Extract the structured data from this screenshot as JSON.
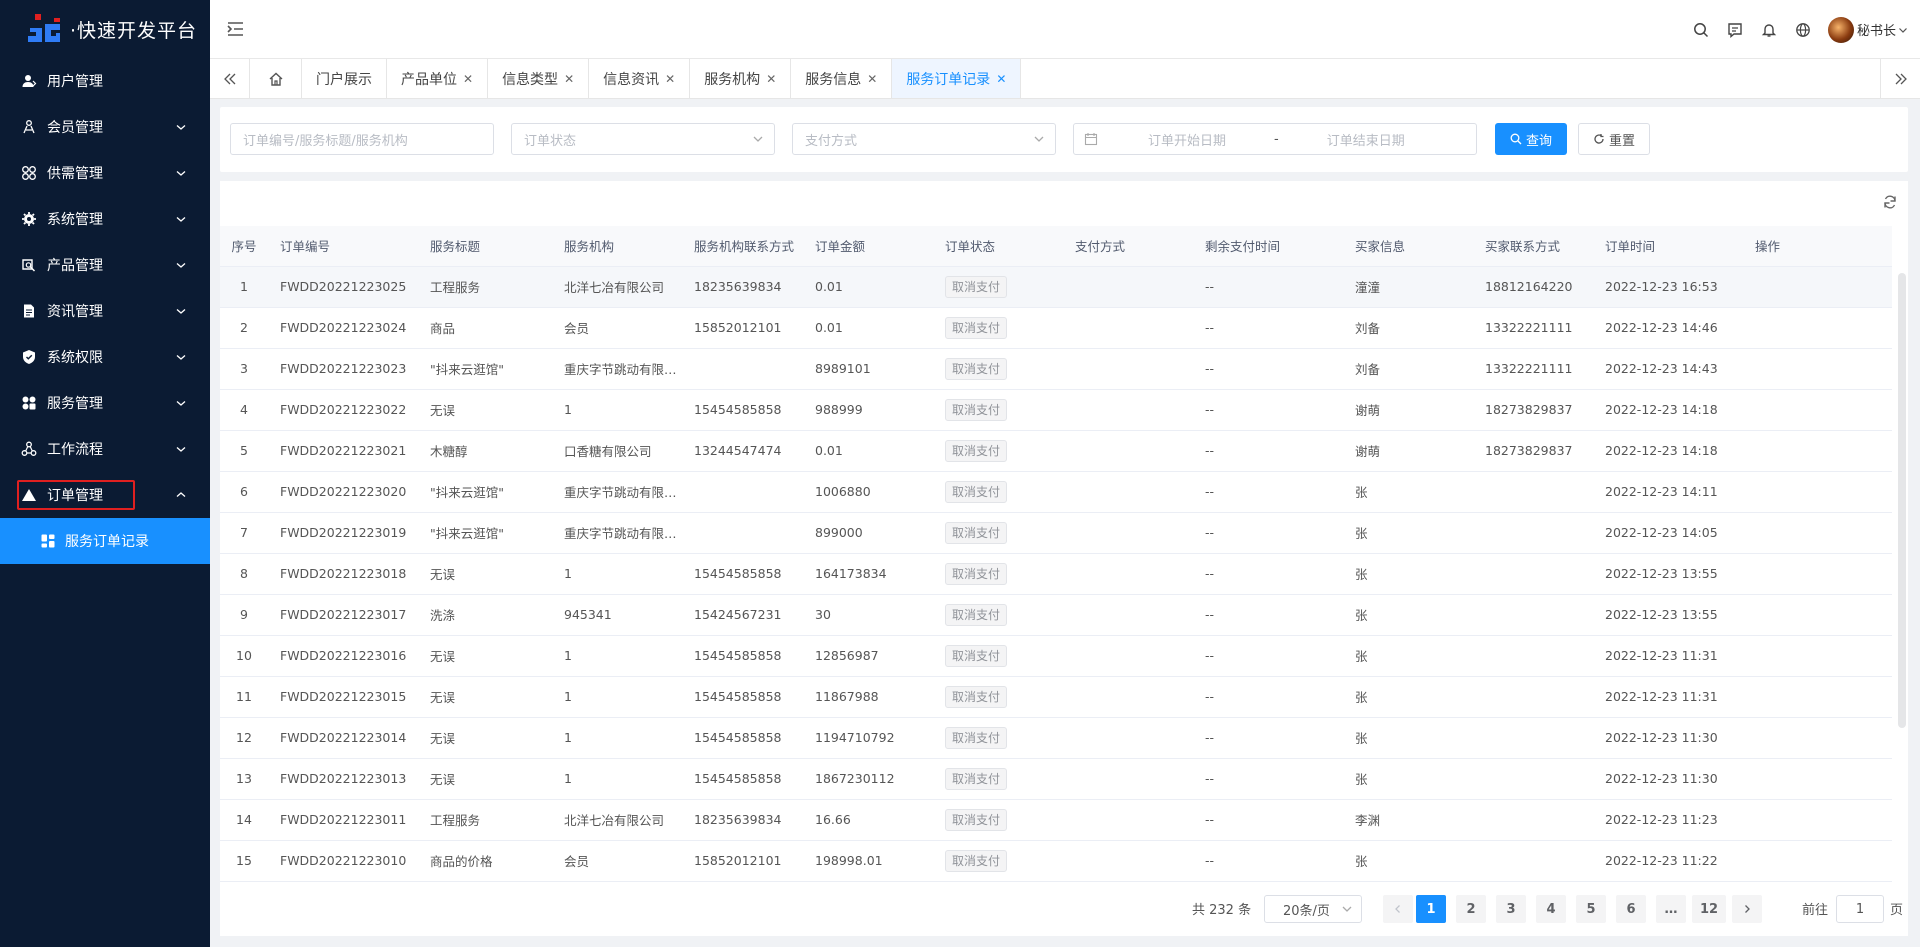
{
  "app": {
    "title": "·快速开发平台"
  },
  "sidebar": {
    "items": [
      {
        "label": "用户管理",
        "icon": "user-icon"
      },
      {
        "label": "会员管理",
        "icon": "members-icon"
      },
      {
        "label": "供需管理",
        "icon": "supply-icon"
      },
      {
        "label": "系统管理",
        "icon": "gear-icon"
      },
      {
        "label": "产品管理",
        "icon": "product-icon"
      },
      {
        "label": "资讯管理",
        "icon": "document-icon"
      },
      {
        "label": "系统权限",
        "icon": "shield-icon"
      },
      {
        "label": "服务管理",
        "icon": "grid-icon"
      },
      {
        "label": "工作流程",
        "icon": "workflow-icon"
      },
      {
        "label": "订单管理",
        "icon": "triangle-icon"
      }
    ],
    "sub_item": {
      "label": "服务订单记录",
      "icon": "dashboard-icon"
    }
  },
  "header": {
    "user_name": "秘书长"
  },
  "tabs": [
    {
      "label": "门户展示",
      "closable": false
    },
    {
      "label": "产品单位",
      "closable": true
    },
    {
      "label": "信息类型",
      "closable": true
    },
    {
      "label": "信息资讯",
      "closable": true
    },
    {
      "label": "服务机构",
      "closable": true
    },
    {
      "label": "服务信息",
      "closable": true
    },
    {
      "label": "服务订单记录",
      "closable": true,
      "active": true
    }
  ],
  "filters": {
    "keyword_placeholder": "订单编号/服务标题/服务机构",
    "status_placeholder": "订单状态",
    "pay_placeholder": "支付方式",
    "start_date_placeholder": "订单开始日期",
    "date_separator": "-",
    "end_date_placeholder": "订单结束日期",
    "search_label": "查询",
    "reset_label": "重置"
  },
  "table": {
    "columns": [
      "序号",
      "订单编号",
      "服务标题",
      "服务机构",
      "服务机构联系方式",
      "订单金额",
      "订单状态",
      "支付方式",
      "剩余支付时间",
      "买家信息",
      "买家联系方式",
      "订单时间",
      "操作"
    ],
    "rows": [
      [
        "1",
        "FWDD20221223025",
        "工程服务",
        "北洋七冶有限公司",
        "18235639834",
        "0.01",
        "取消支付",
        "",
        "--",
        "潼潼",
        "18812164220",
        "2022-12-23 16:53"
      ],
      [
        "2",
        "FWDD20221223024",
        "商品",
        "会员",
        "15852012101",
        "0.01",
        "取消支付",
        "",
        "--",
        "刘备",
        "13322221111",
        "2022-12-23 14:46"
      ],
      [
        "3",
        "FWDD20221223023",
        "\"抖来云逛馆\"",
        "重庆字节跳动有限公司",
        "",
        "8989101",
        "取消支付",
        "",
        "--",
        "刘备",
        "13322221111",
        "2022-12-23 14:43"
      ],
      [
        "4",
        "FWDD20221223022",
        "无误",
        "1",
        "15454585858",
        "988999",
        "取消支付",
        "",
        "--",
        "谢萌",
        "18273829837",
        "2022-12-23 14:18"
      ],
      [
        "5",
        "FWDD20221223021",
        "木糖醇",
        "口香糖有限公司",
        "13244547474",
        "0.01",
        "取消支付",
        "",
        "--",
        "谢萌",
        "18273829837",
        "2022-12-23 14:18"
      ],
      [
        "6",
        "FWDD20221223020",
        "\"抖来云逛馆\"",
        "重庆字节跳动有限公司",
        "",
        "1006880",
        "取消支付",
        "",
        "--",
        "张",
        "",
        "2022-12-23 14:11"
      ],
      [
        "7",
        "FWDD20221223019",
        "\"抖来云逛馆\"",
        "重庆字节跳动有限公司",
        "",
        "899000",
        "取消支付",
        "",
        "--",
        "张",
        "",
        "2022-12-23 14:05"
      ],
      [
        "8",
        "FWDD20221223018",
        "无误",
        "1",
        "15454585858",
        "164173834",
        "取消支付",
        "",
        "--",
        "张",
        "",
        "2022-12-23 13:55"
      ],
      [
        "9",
        "FWDD20221223017",
        "洗涤",
        "945341",
        "15424567231",
        "30",
        "取消支付",
        "",
        "--",
        "张",
        "",
        "2022-12-23 13:55"
      ],
      [
        "10",
        "FWDD20221223016",
        "无误",
        "1",
        "15454585858",
        "12856987",
        "取消支付",
        "",
        "--",
        "张",
        "",
        "2022-12-23 11:31"
      ],
      [
        "11",
        "FWDD20221223015",
        "无误",
        "1",
        "15454585858",
        "11867988",
        "取消支付",
        "",
        "--",
        "张",
        "",
        "2022-12-23 11:31"
      ],
      [
        "12",
        "FWDD20221223014",
        "无误",
        "1",
        "15454585858",
        "1194710792",
        "取消支付",
        "",
        "--",
        "张",
        "",
        "2022-12-23 11:30"
      ],
      [
        "13",
        "FWDD20221223013",
        "无误",
        "1",
        "15454585858",
        "1867230112",
        "取消支付",
        "",
        "--",
        "张",
        "",
        "2022-12-23 11:30"
      ],
      [
        "14",
        "FWDD20221223011",
        "工程服务",
        "北洋七冶有限公司",
        "18235639834",
        "16.66",
        "取消支付",
        "",
        "--",
        "李渊",
        "",
        "2022-12-23 11:23"
      ],
      [
        "15",
        "FWDD20221223010",
        "商品的价格",
        "会员",
        "15852012101",
        "198998.01",
        "取消支付",
        "",
        "--",
        "张",
        "",
        "2022-12-23 11:22"
      ]
    ]
  },
  "pagination": {
    "total_text": "共 232 条",
    "page_size": "20条/页",
    "pages": [
      "1",
      "2",
      "3",
      "4",
      "5",
      "6",
      "…",
      "12"
    ],
    "current": "1",
    "goto_label": "前往",
    "goto_value": "1",
    "goto_unit": "页"
  },
  "colors": {
    "primary": "#1890ff",
    "sidebar_bg": "#0b1b33",
    "highlight": "#e02020"
  }
}
